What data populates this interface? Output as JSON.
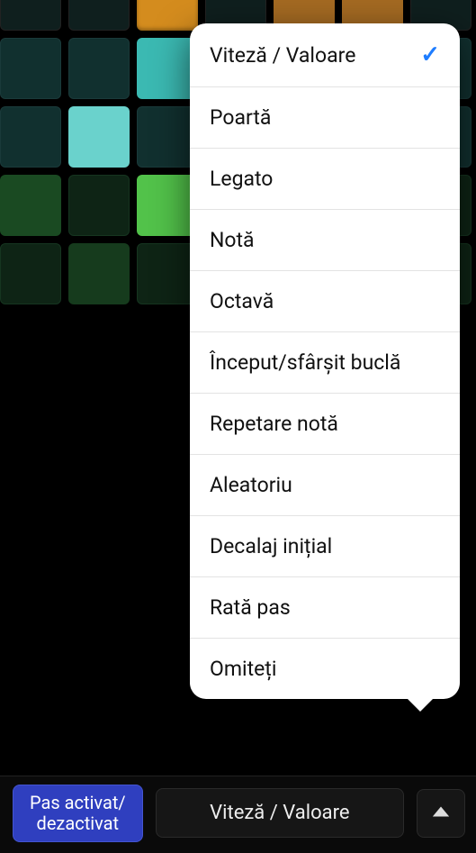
{
  "toolbar": {
    "step_toggle_label": "Pas activat/\ndezactivat",
    "mode_button_label": "Viteză / Valoare"
  },
  "mode_menu": {
    "selected_index": 0,
    "items": [
      "Viteză / Valoare",
      "Poartă",
      "Legato",
      "Notă",
      "Octavă",
      "Început/sfârșit buclă",
      "Repetare notă",
      "Aleatoriu",
      "Decalaj inițial",
      "Rată pas",
      "Omiteți"
    ]
  }
}
